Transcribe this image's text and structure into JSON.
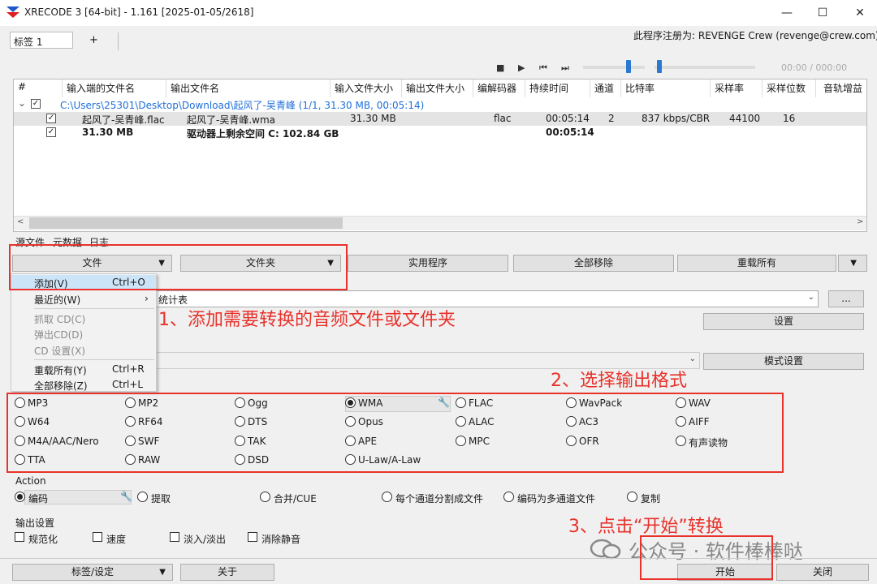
{
  "window": {
    "title": "XRECODE 3 [64-bit] - 1.161 [2025-01-05/2618]",
    "minimize": "—",
    "maximize": "☐",
    "close": "✕",
    "registration": "此程序注册为: REVENGE Crew (revenge@crew.com)"
  },
  "tabs": {
    "active": "标签 1",
    "add": "+"
  },
  "player": {
    "stop": "■",
    "play": "▶",
    "prev": "⏮",
    "next": "⏭",
    "time": "00:00 / 000:00"
  },
  "filelist": {
    "columns": [
      "#",
      "输入端的文件名",
      "输出文件名",
      "输入文件大小",
      "输出文件大小",
      "编解码器",
      "持续时间",
      "通道",
      "比特率",
      "采样率",
      "采样位数",
      "音轨增益"
    ],
    "group_path": "C:\\Users\\25301\\Desktop\\Download\\起风了-吴青峰 (1/1, 31.30 MB, 00:05:14)",
    "row": {
      "input": "起风了-吴青峰.flac",
      "output": "起风了-吴青峰.wma",
      "input_size": "31.30 MB",
      "codec": "flac",
      "duration": "00:05:14",
      "channels": "2",
      "bitrate": "837 kbps/CBR",
      "samplerate": "44100",
      "bits": "16"
    },
    "summary": {
      "size": "31.30 MB",
      "free": "驱动器上剩余空间 C: 102.84 GB",
      "duration": "00:05:14"
    },
    "check": "✓",
    "expand": "⌄",
    "scroll_left": "<",
    "scroll_right": ">"
  },
  "bottom_tabs": [
    "源文件",
    "元数据",
    "日志"
  ],
  "toolbar": {
    "file": "文件",
    "folder": "文件夹",
    "utilities": "实用程序",
    "remove_all": "全部移除",
    "reload_all": "重载所有",
    "dropdown_arrow": "▼"
  },
  "file_menu": {
    "add": "添加(V)",
    "add_sc": "Ctrl+O",
    "recent": "最近的(W)",
    "recent_arrow": "›",
    "rip_cd": "抓取 CD(C)",
    "eject_cd": "弹出CD(D)",
    "cd_settings": "CD 设置(X)",
    "reload_all": "重载所有(Y)",
    "reload_sc": "Ctrl+R",
    "remove_all": "全部移除(Z)",
    "remove_sc": "Ctrl+L"
  },
  "output": {
    "path_value": "统计表",
    "browse": "...",
    "settings": "设置",
    "mode_settings": "模式设置",
    "combo_arrow": "⌄"
  },
  "formats": [
    [
      "MP3",
      "MP2",
      "Ogg",
      "WMA",
      "FLAC",
      "WavPack",
      "WAV"
    ],
    [
      "W64",
      "RF64",
      "DTS",
      "Opus",
      "ALAC",
      "AC3",
      "AIFF"
    ],
    [
      "M4A/AAC/Nero",
      "SWF",
      "TAK",
      "APE",
      "MPC",
      "OFR",
      "有声读物"
    ],
    [
      "TTA",
      "RAW",
      "DSD",
      "U-Law/A-Law"
    ]
  ],
  "selected_format": "WMA",
  "wrench": "🔧",
  "action": {
    "label": "Action",
    "options": [
      "编码",
      "提取",
      "合并/CUE",
      "每个通道分割成文件",
      "编码为多通道文件",
      "复制"
    ]
  },
  "output_settings": {
    "label": "输出设置",
    "options": [
      "规范化",
      "速度",
      "淡入/淡出",
      "消除静音"
    ]
  },
  "footer": {
    "tags": "标签/设定",
    "about": "关于",
    "start": "开始",
    "close": "关闭"
  },
  "annotations": {
    "step1": "1、添加需要转换的音频文件或文件夹",
    "step2": "2、选择输出格式",
    "step3": "3、点击“开始”转换"
  },
  "watermark": "公众号 · 软件棒棒哒",
  "colors": {
    "annotation_red": "#e8322b",
    "path_blue": "#1e6fd9",
    "slider_blue": "#2b78d1",
    "menu_highlight": "#cce4f7"
  }
}
